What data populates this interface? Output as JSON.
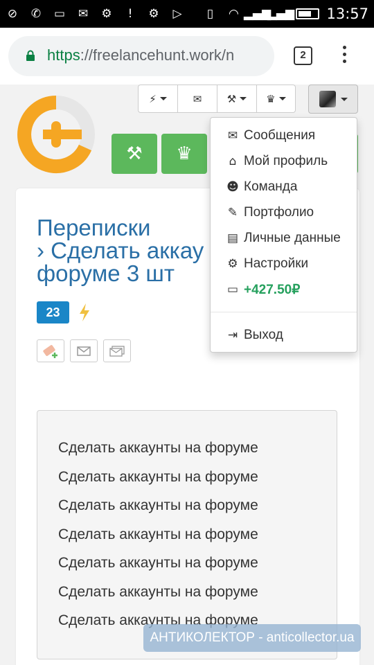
{
  "status_bar": {
    "time": "13:57",
    "icons": [
      "no-sim-icon",
      "viber-icon",
      "image-icon",
      "message-icon",
      "android-debug-icon",
      "alert-icon",
      "play-store-icon",
      "vibrate-icon",
      "wifi-icon",
      "signal-1-icon",
      "signal-2-icon",
      "battery-icon"
    ]
  },
  "browser": {
    "url_scheme": "https",
    "url_rest": "://freelancehunt.work/n",
    "tab_count": "2"
  },
  "header": {
    "top_buttons": [
      "bolt-icon",
      "envelope-icon",
      "gavel-icon",
      "trophy-icon"
    ],
    "green_buttons": [
      "gavel-icon",
      "trophy-icon"
    ]
  },
  "page": {
    "title_line1": "Переписки",
    "title_line2": "› Сделать аккау",
    "title_line3": "форуме 3 шт",
    "badge": "23",
    "message_lines": [
      "Сделать аккаунты на форуме",
      "Сделать аккаунты на форуме",
      "Сделать аккаунты на форуме",
      "Сделать аккаунты на форуме",
      "Сделать аккаунты на форуме",
      "Сделать аккаунты на форуме",
      "Сделать аккаунты на форуме"
    ]
  },
  "dropdown": {
    "items": [
      {
        "label": "Сообщения",
        "icon": "envelope-icon"
      },
      {
        "label": "Мой профиль",
        "icon": "home-icon"
      },
      {
        "label": "Команда",
        "icon": "users-icon"
      },
      {
        "label": "Портфолио",
        "icon": "brush-icon"
      },
      {
        "label": "Личные данные",
        "icon": "id-card-icon"
      },
      {
        "label": "Настройки",
        "icon": "gear-icon"
      },
      {
        "label": "+427.50₽",
        "icon": "credit-card-icon"
      }
    ],
    "logout": {
      "label": "Выход",
      "icon": "sign-out-icon"
    }
  },
  "watermark": "АНТИКОЛЕКТОР - anticollector.ua",
  "colors": {
    "accent_blue": "#2a6fa6",
    "green": "#5cb85c",
    "badge_blue": "#1a86c7",
    "money_green": "#25a05d",
    "logo_orange": "#f5a623"
  }
}
